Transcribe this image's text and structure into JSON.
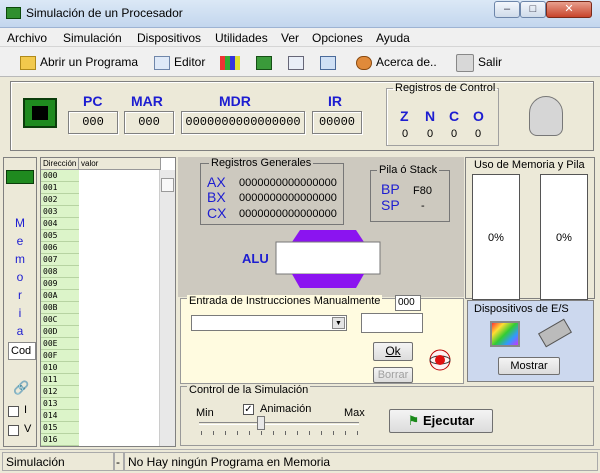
{
  "window": {
    "title": "Simulación de un Procesador"
  },
  "menu": [
    "Archivo",
    "Simulación",
    "Dispositivos",
    "Utilidades",
    "Ver",
    "Opciones",
    "Ayuda"
  ],
  "toolbar": {
    "open_program": "Abrir un Programa",
    "editor": "Editor",
    "about": "Acerca de..",
    "exit": "Salir"
  },
  "registers": {
    "pc_label": "PC",
    "pc_value": "000",
    "mar_label": "MAR",
    "mar_value": "000",
    "mdr_label": "MDR",
    "mdr_value": "0000000000000000",
    "ir_label": "IR",
    "ir_value": "00000"
  },
  "control_registers": {
    "title": "Registros de Control",
    "flags": [
      {
        "name": "Z",
        "value": "0"
      },
      {
        "name": "N",
        "value": "0"
      },
      {
        "name": "C",
        "value": "0"
      },
      {
        "name": "O",
        "value": "0"
      }
    ]
  },
  "memory": {
    "side_label": "M e m o r i a",
    "col_address": "Dirección",
    "col_value": "valor",
    "cod_label": "Cod",
    "check_i": "I",
    "check_v": "V",
    "addresses": [
      "000",
      "001",
      "002",
      "003",
      "004",
      "005",
      "006",
      "007",
      "008",
      "009",
      "00A",
      "00B",
      "00C",
      "00D",
      "00E",
      "00F",
      "010",
      "011",
      "012",
      "013",
      "014",
      "015",
      "016"
    ]
  },
  "general_registers": {
    "title": "Registros Generales",
    "items": [
      {
        "name": "AX",
        "value": "0000000000000000"
      },
      {
        "name": "BX",
        "value": "0000000000000000"
      },
      {
        "name": "CX",
        "value": "0000000000000000"
      }
    ]
  },
  "stack": {
    "title": "Pila ó Stack",
    "bp_label": "BP",
    "bp_value": "F80",
    "sp_label": "SP",
    "sp_value": "-"
  },
  "alu": {
    "label": "ALU"
  },
  "memory_usage": {
    "title": "Uso de Memoria y Pila",
    "memory_pct": "0%",
    "stack_pct": "0%"
  },
  "manual_input": {
    "title": "Entrada de Instrucciones Manualmente",
    "counter": "000",
    "ok_label": "Ok",
    "clear_label": "Borrar"
  },
  "io_devices": {
    "title": "Dispositivos de E/S",
    "show_label": "Mostrar"
  },
  "sim_control": {
    "title": "Control de la Simulación",
    "min_label": "Min",
    "max_label": "Max",
    "animation_label": "Animación",
    "animation_checked": true,
    "execute_label": "Ejecutar"
  },
  "status": {
    "state": "Simulación Detenida",
    "sep": "-",
    "message": "No Hay ningún Programa en Memoria"
  }
}
